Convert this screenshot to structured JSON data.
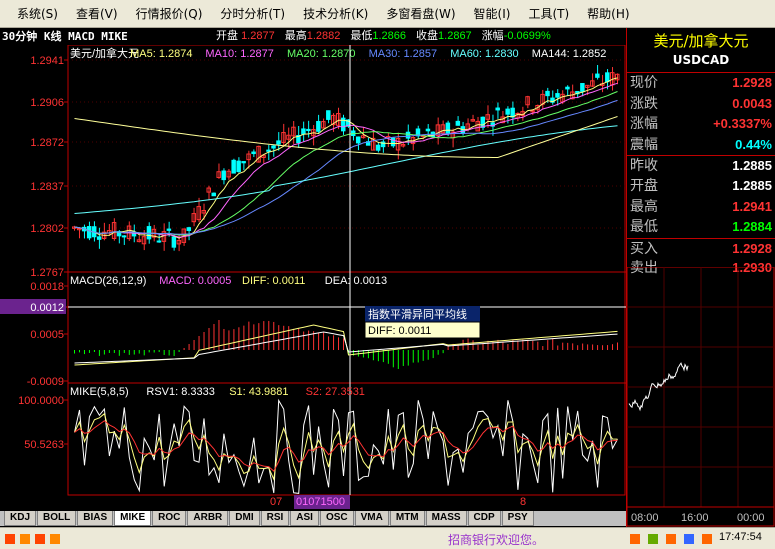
{
  "menu": [
    {
      "label": "系统(S)"
    },
    {
      "label": "查看(V)"
    },
    {
      "label": "行情报价(Q)"
    },
    {
      "label": "分时分析(T)"
    },
    {
      "label": "技术分析(K)"
    },
    {
      "label": "多窗看盘(W)"
    },
    {
      "label": "智能(I)"
    },
    {
      "label": "工具(T)"
    },
    {
      "label": "帮助(H)"
    }
  ],
  "chart_header": {
    "title": "30分钟 K线 MACD MIKE",
    "open_label": "开盘",
    "open": "1.2877",
    "high_label": "最高",
    "high": "1.2882",
    "low_label": "最低",
    "low": "1.2866",
    "close_label": "收盘",
    "close": "1.2867",
    "change_label": "涨幅",
    "change": "-0.0699%"
  },
  "price_pane": {
    "legend": [
      {
        "text": "美元/加拿大元",
        "color": "#ffffff"
      },
      {
        "text": "MA5: 1.2874",
        "color": "#ffff80"
      },
      {
        "text": "MA10: 1.2877",
        "color": "#ff66ff"
      },
      {
        "text": "MA20: 1.2870",
        "color": "#66ff66"
      },
      {
        "text": "MA30: 1.2857",
        "color": "#6688ff"
      },
      {
        "text": "MA60: 1.2830",
        "color": "#66ffff"
      },
      {
        "text": "MA144: 1.2852",
        "color": "#ffffff"
      }
    ],
    "axis_labels": [
      "1.2941",
      "1.2906",
      "1.2872",
      "1.2837",
      "1.2802",
      "1.2767"
    ]
  },
  "macd_pane": {
    "legend": [
      {
        "text": "MACD(26,12,9)",
        "color": "#ffffff"
      },
      {
        "text": "MACD: 0.0005",
        "color": "#ff66ff"
      },
      {
        "text": "DIFF: 0.0011",
        "color": "#ffff80"
      },
      {
        "text": "DEA: 0.0013",
        "color": "#ffffff"
      }
    ],
    "axis_labels": [
      "0.0018",
      "0.0012",
      "0.0005",
      "-0.0009"
    ],
    "tooltip_title": "指数平滑异同平均线",
    "tooltip_value": "DIFF: 0.0011"
  },
  "mike_pane": {
    "legend": [
      {
        "text": "MIKE(5,8,5)",
        "color": "#ffffff"
      },
      {
        "text": "RSV1: 8.3333",
        "color": "#ffffff"
      },
      {
        "text": "S1: 43.9881",
        "color": "#ffff80"
      },
      {
        "text": "S2: 27.3531",
        "color": "#ff3333"
      }
    ],
    "axis_labels": [
      "100.0000",
      "50.5263"
    ]
  },
  "x_axis": {
    "label_left": "07",
    "cursor_time": "01071500",
    "label_right": "8"
  },
  "tabs": [
    "KDJ",
    "BOLL",
    "BIAS",
    "MIKE",
    "ROC",
    "ARBR",
    "DMI",
    "RSI",
    "ASI",
    "OSC",
    "VMA",
    "MTM",
    "MASS",
    "CDP",
    "PSY"
  ],
  "active_tab": "MIKE",
  "side": {
    "name": "美元/加拿大元",
    "code": "USDCAD",
    "quotes": [
      {
        "label": "现价",
        "value": "1.2928",
        "color": "#ff3333"
      },
      {
        "label": "涨跌",
        "value": "0.0043",
        "color": "#ff3333"
      },
      {
        "label": "涨幅",
        "value": "+0.3337%",
        "color": "#ff3333"
      },
      {
        "label": "震幅",
        "value": "0.44%",
        "color": "#00ffff"
      },
      {
        "label": "昨收",
        "value": "1.2885",
        "color": "#ffffff"
      },
      {
        "label": "开盘",
        "value": "1.2885",
        "color": "#ffffff"
      },
      {
        "label": "最高",
        "value": "1.2941",
        "color": "#ff3333"
      },
      {
        "label": "最低",
        "value": "1.2884",
        "color": "#00ff00"
      },
      {
        "label": "买入",
        "value": "1.2928",
        "color": "#ff3333"
      },
      {
        "label": "卖出",
        "value": "1.2930",
        "color": "#ff3333"
      }
    ],
    "mini_times": [
      "08:00",
      "16:00",
      "00:00"
    ]
  },
  "status": {
    "ticker": "招商银行欢迎您。",
    "clock": "17:47:54"
  },
  "colors": {
    "up": "#ff3333",
    "down": "#00ffff",
    "grid": "#800000",
    "frame": "#c00000"
  }
}
